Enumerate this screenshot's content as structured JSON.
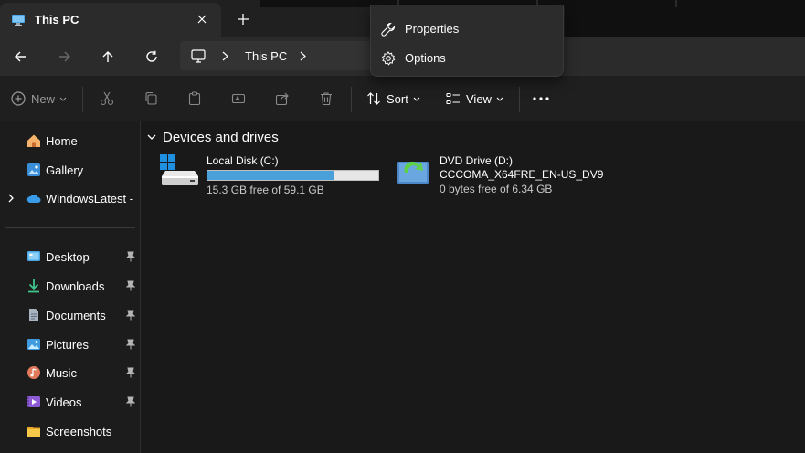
{
  "window": {
    "tab_title": "This PC"
  },
  "address_bar": {
    "crumbs": [
      "This PC"
    ]
  },
  "command_bar": {
    "new_label": "New",
    "sort_label": "Sort",
    "view_label": "View"
  },
  "sidebar": {
    "top_items": [
      {
        "label": "Home",
        "icon": "home-icon"
      },
      {
        "label": "Gallery",
        "icon": "gallery-icon"
      },
      {
        "label": "WindowsLatest - Pe",
        "icon": "onedrive-icon"
      }
    ],
    "pinned_items": [
      {
        "label": "Desktop",
        "icon": "desktop-folder-icon"
      },
      {
        "label": "Downloads",
        "icon": "downloads-icon"
      },
      {
        "label": "Documents",
        "icon": "documents-icon"
      },
      {
        "label": "Pictures",
        "icon": "pictures-icon"
      },
      {
        "label": "Music",
        "icon": "music-icon"
      },
      {
        "label": "Videos",
        "icon": "videos-icon"
      },
      {
        "label": "Screenshots",
        "icon": "folder-icon"
      }
    ]
  },
  "main": {
    "group_title": "Devices and drives",
    "drives": [
      {
        "name": "Local Disk (C:)",
        "space": "15.3 GB free of 59.1 GB",
        "used_fraction": 0.74,
        "icon": "local-disk-icon"
      },
      {
        "name": "DVD Drive (D:)",
        "label": "CCCOMA_X64FRE_EN-US_DV9",
        "space": "0 bytes free of 6.34 GB",
        "icon": "dvd-drive-icon"
      }
    ]
  },
  "context_menu": {
    "items": [
      {
        "label": "Properties",
        "icon": "wrench-icon"
      },
      {
        "label": "Options",
        "icon": "gear-icon"
      }
    ]
  },
  "colors": {
    "accent": "#4aa0d8",
    "background": "#191919"
  }
}
